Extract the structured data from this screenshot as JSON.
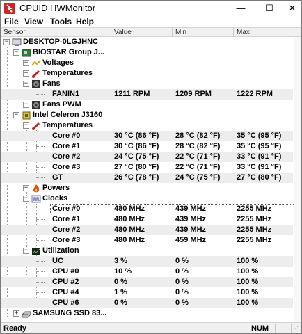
{
  "window": {
    "title": "CPUID HWMonitor"
  },
  "controls": {
    "minimize": "—",
    "maximize": "☐",
    "close": "✕"
  },
  "menu": {
    "file": "File",
    "view": "View",
    "tools": "Tools",
    "help": "Help"
  },
  "columns": [
    "Sensor",
    "Value",
    "Min",
    "Max"
  ],
  "tree": {
    "root": "DESKTOP-0LGJHNC",
    "motherboard": "BIOSTAR Group J...",
    "voltages": "Voltages",
    "temperatures": "Temperatures",
    "fans": "Fans",
    "fanin1": {
      "name": "FANIN1",
      "value": "1211 RPM",
      "min": "1209 RPM",
      "max": "1222 RPM"
    },
    "fans_pwm": "Fans PWM",
    "cpu": "Intel Celeron J3160",
    "cpu_temperatures": "Temperatures",
    "temps": [
      {
        "name": "Core #0",
        "value": "30 °C  (86 °F)",
        "min": "28 °C  (82 °F)",
        "max": "35 °C  (95 °F)"
      },
      {
        "name": "Core #1",
        "value": "30 °C  (86 °F)",
        "min": "28 °C  (82 °F)",
        "max": "35 °C  (95 °F)"
      },
      {
        "name": "Core #2",
        "value": "24 °C  (75 °F)",
        "min": "22 °C  (71 °F)",
        "max": "33 °C  (91 °F)"
      },
      {
        "name": "Core #3",
        "value": "27 °C  (80 °F)",
        "min": "22 °C  (71 °F)",
        "max": "33 °C  (91 °F)"
      },
      {
        "name": "GT",
        "value": "26 °C  (78 °F)",
        "min": "24 °C  (75 °F)",
        "max": "27 °C  (80 °F)"
      }
    ],
    "powers": "Powers",
    "clocks": "Clocks",
    "clock_rows": [
      {
        "name": "Core #0",
        "value": "480 MHz",
        "min": "439 MHz",
        "max": "2255 MHz"
      },
      {
        "name": "Core #1",
        "value": "480 MHz",
        "min": "439 MHz",
        "max": "2255 MHz"
      },
      {
        "name": "Core #2",
        "value": "480 MHz",
        "min": "439 MHz",
        "max": "2255 MHz"
      },
      {
        "name": "Core #3",
        "value": "480 MHz",
        "min": "459 MHz",
        "max": "2255 MHz"
      }
    ],
    "utilization": "Utilization",
    "util_rows": [
      {
        "name": "UC",
        "value": "3 %",
        "min": "0 %",
        "max": "100 %"
      },
      {
        "name": "CPU #0",
        "value": "10 %",
        "min": "0 %",
        "max": "100 %"
      },
      {
        "name": "CPU #2",
        "value": "0 %",
        "min": "0 %",
        "max": "100 %"
      },
      {
        "name": "CPU #4",
        "value": "1 %",
        "min": "0 %",
        "max": "100 %"
      },
      {
        "name": "CPU #6",
        "value": "0 %",
        "min": "0 %",
        "max": "100 %"
      }
    ],
    "ssd": "SAMSUNG SSD 83..."
  },
  "status": {
    "text": "Ready",
    "num": "NUM"
  },
  "colors": {
    "accent": "#d42222",
    "alt_row": "#ededed"
  }
}
